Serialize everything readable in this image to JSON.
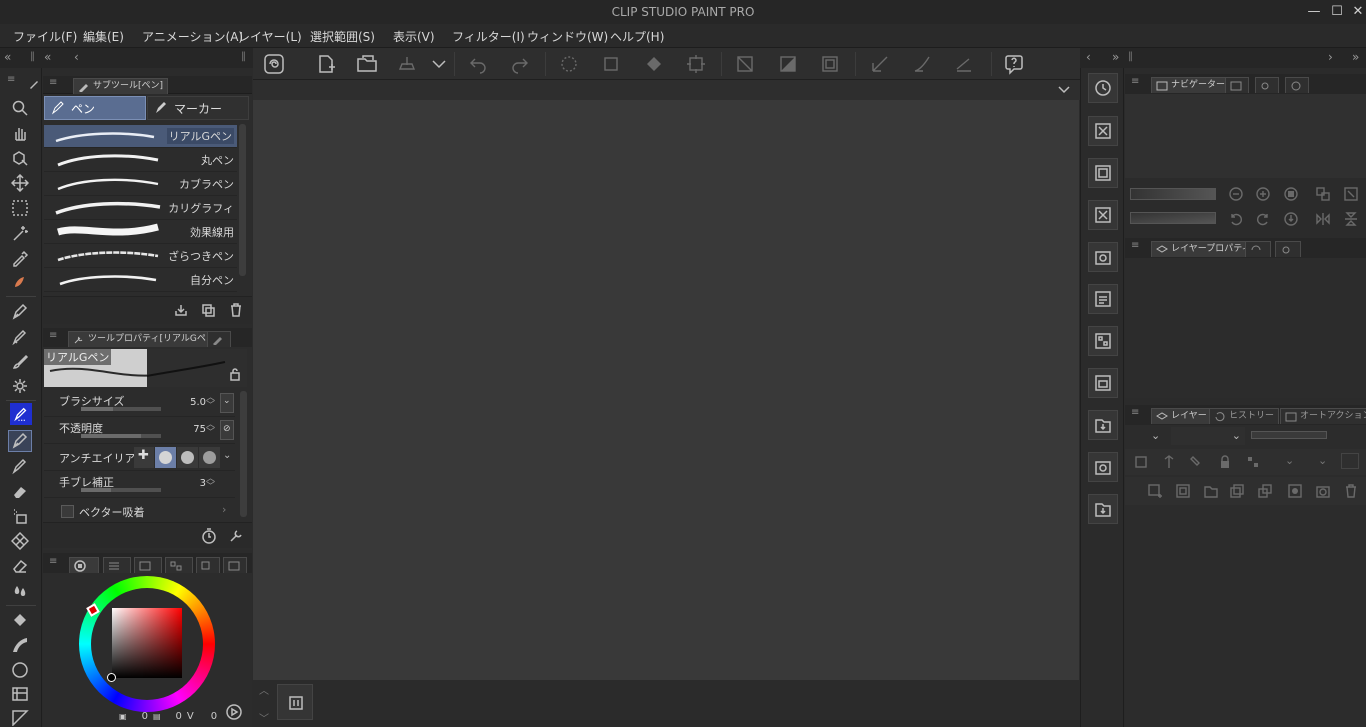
{
  "app": {
    "title": "CLIP STUDIO PAINT PRO",
    "window_buttons": {
      "minimize": "—",
      "maximize": "☐",
      "close": "✕"
    }
  },
  "menu": [
    "ファイル(F)",
    "編集(E)",
    "アニメーション(A)",
    "レイヤー(L)",
    "選択範囲(S)",
    "表示(V)",
    "フィルター(I)",
    "ウィンドウ(W)",
    "ヘルプ(H)"
  ],
  "command_bar": {
    "icons": [
      "clip-studio-icon",
      "new-file-icon",
      "open-folder-icon",
      "export-icon",
      "dropdown-icon",
      "undo-icon",
      "redo-icon",
      "loading-icon",
      "clear-selection-icon",
      "fill-icon",
      "transform-icon",
      "deselect-icon",
      "invert-selection-icon",
      "crop-icon",
      "ruler-icon",
      "snap-icon",
      "special-ruler-icon",
      "help-icon"
    ]
  },
  "subtool_panel": {
    "header_tab": "サブツール[ペン]",
    "tabs": [
      "ペン",
      "マーカー"
    ],
    "brushes": [
      {
        "name": "リアルGペン",
        "selected": true
      },
      {
        "name": "丸ペン",
        "selected": false
      },
      {
        "name": "カブラペン",
        "selected": false
      },
      {
        "name": "カリグラフィ",
        "selected": false
      },
      {
        "name": "効果線用",
        "selected": false
      },
      {
        "name": "ざらつきペン",
        "selected": false
      },
      {
        "name": "自分ペン",
        "selected": false
      }
    ]
  },
  "tool_property": {
    "header_tab": "ツールプロパティ[リアルGペン]",
    "preview_label": "リアルGペン",
    "brush_size": {
      "label": "ブラシサイズ",
      "value": "5.0"
    },
    "opacity": {
      "label": "不透明度",
      "value": "75"
    },
    "antialias": {
      "label": "アンチエイリアス"
    },
    "stabilization": {
      "label": "手ブレ補正",
      "value": "3"
    },
    "vector_snap": {
      "label": "ベクター吸着",
      "checked": false
    }
  },
  "color_panel": {
    "readout": {
      "h": "0",
      "s": "0",
      "v": "0",
      "v_label": "V"
    },
    "main_color": "#1c2130",
    "sub_color": "#f4eeee"
  },
  "right_panels": {
    "navigator_tab": "ナビゲーター",
    "layer_property_tab": "レイヤープロパティ",
    "layer_tabs": [
      "レイヤー",
      "ヒストリー",
      "オートアクション"
    ]
  },
  "colors": {
    "accent_selected": "#4a5a78",
    "active_tool": "#1f2fd0"
  }
}
